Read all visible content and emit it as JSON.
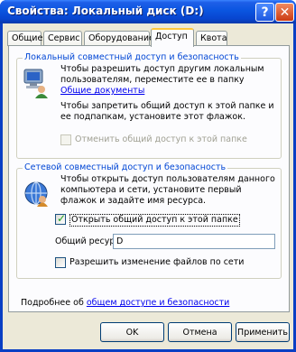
{
  "window": {
    "title": "Свойства: Локальный диск (D:)"
  },
  "titlebar": {
    "help_label": "?",
    "close_label": "✕"
  },
  "tabs": [
    {
      "label": "Общие"
    },
    {
      "label": "Сервис"
    },
    {
      "label": "Оборудование"
    },
    {
      "label": "Доступ"
    },
    {
      "label": "Квота"
    }
  ],
  "local_group": {
    "title": "Локальный совместный доступ и безопасность",
    "text1": "Чтобы разрешить доступ другим локальным пользователям, переместите ее в папку",
    "text1_link": "Общие документы",
    "text2": "Чтобы запретить общий доступ к этой папке и ее подпапкам, установите этот флажок.",
    "checkbox_label": "Отменить общий доступ к этой папке"
  },
  "network_group": {
    "title": "Сетевой совместный доступ и безопасность",
    "text": "Чтобы открыть доступ пользователям данного компьютера и сети, установите первый флажок и задайте имя ресурса.",
    "share_checkbox_label": "Открыть общий доступ к этой папке",
    "share_name_label": "Общий ресурс:",
    "share_name_value": "D",
    "allow_changes_label": "Разрешить изменение файлов по сети"
  },
  "footer": {
    "more_prefix": "Подробнее об",
    "more_link": "общем доступе и безопасности"
  },
  "buttons": {
    "ok": "OK",
    "cancel": "Отмена",
    "apply": "Применить"
  }
}
